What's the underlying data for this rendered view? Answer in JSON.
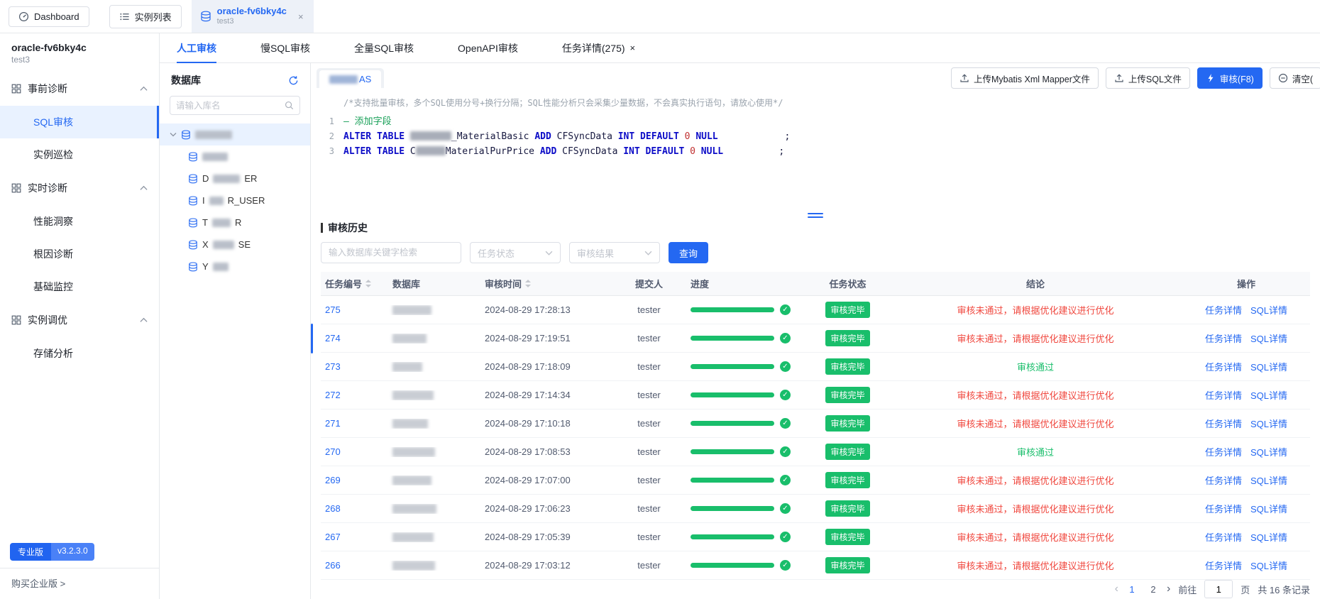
{
  "colors": {
    "primary": "#2468F2",
    "success": "#19BE6B",
    "danger": "#F0483F"
  },
  "icons": {
    "close": "×",
    "check": "✓"
  },
  "topbar": {
    "dashboard": "Dashboard",
    "instance_list": "实例列表",
    "tab": {
      "title": "oracle-fv6bky4c",
      "subtitle": "test3",
      "close": "×"
    }
  },
  "sidebar": {
    "instance_name": "oracle-fv6bky4c",
    "instance_sub": "test3",
    "groups": [
      {
        "label": "事前诊断",
        "items": [
          {
            "label": "SQL审核",
            "active": true
          },
          {
            "label": "实例巡检",
            "active": false
          }
        ]
      },
      {
        "label": "实时诊断",
        "items": [
          {
            "label": "性能洞察",
            "active": false
          },
          {
            "label": "根因诊断",
            "active": false
          },
          {
            "label": "基础监控",
            "active": false
          }
        ]
      },
      {
        "label": "实例调优",
        "items": [
          {
            "label": "存储分析",
            "active": false
          }
        ]
      }
    ],
    "edition": "专业版",
    "version": "v3.2.3.0",
    "buy": "购买企业版 >"
  },
  "main_tabs": [
    {
      "label": "人工审核",
      "active": true,
      "closable": false
    },
    {
      "label": "慢SQL审核",
      "active": false,
      "closable": false
    },
    {
      "label": "全量SQL审核",
      "active": false,
      "closable": false
    },
    {
      "label": "OpenAPI审核",
      "active": false,
      "closable": false
    },
    {
      "label": "任务详情(275)",
      "active": false,
      "closable": true
    }
  ],
  "db_panel": {
    "title": "数据库",
    "search_placeholder": "请输入库名",
    "tree": [
      {
        "root": true,
        "selected": true,
        "prefix": "",
        "redact": 52,
        "suffix": ""
      },
      {
        "root": false,
        "selected": false,
        "prefix": "",
        "redact": 36,
        "suffix": ""
      },
      {
        "root": false,
        "selected": false,
        "prefix": "D",
        "redact": 38,
        "suffix": "ER"
      },
      {
        "root": false,
        "selected": false,
        "prefix": "I",
        "redact": 20,
        "suffix": "R_USER"
      },
      {
        "root": false,
        "selected": false,
        "prefix": "T",
        "redact": 26,
        "suffix": "R"
      },
      {
        "root": false,
        "selected": false,
        "prefix": "X",
        "redact": 30,
        "suffix": "SE"
      },
      {
        "root": false,
        "selected": false,
        "prefix": "Y",
        "redact": 22,
        "suffix": ""
      }
    ]
  },
  "editor": {
    "tab": {
      "redact": 40,
      "suffix": "AS"
    },
    "hint": "/*支持批量审核，多个SQL使用分号+换行分隔；SQL性能分析只会采集少量数据，不会真实执行语句，请放心使用*/",
    "lines": [
      {
        "num": "1",
        "segs": [
          {
            "t": "cmt",
            "v": "— 添加字段"
          }
        ]
      },
      {
        "num": "2",
        "segs": [
          {
            "t": "kw",
            "v": "ALTER TABLE "
          },
          {
            "t": "red",
            "w": 58
          },
          {
            "t": "id",
            "v": "_MaterialBasic "
          },
          {
            "t": "kw",
            "v": "ADD "
          },
          {
            "t": "id",
            "v": "CFSyncData "
          },
          {
            "t": "kw",
            "v": "INT DEFAULT "
          },
          {
            "t": "num",
            "v": "0 "
          },
          {
            "t": "kw",
            "v": "NULL"
          },
          {
            "t": "id",
            "v": "            ;"
          }
        ]
      },
      {
        "num": "3",
        "segs": [
          {
            "t": "kw",
            "v": "ALTER TABLE "
          },
          {
            "t": "id",
            "v": "C"
          },
          {
            "t": "red",
            "w": 42
          },
          {
            "t": "id",
            "v": "MaterialPurPrice "
          },
          {
            "t": "kw",
            "v": "ADD "
          },
          {
            "t": "id",
            "v": "CFSyncData "
          },
          {
            "t": "kw",
            "v": "INT DEFAULT "
          },
          {
            "t": "num",
            "v": "0 "
          },
          {
            "t": "kw",
            "v": "NULL"
          },
          {
            "t": "id",
            "v": "          ;"
          }
        ]
      }
    ]
  },
  "actions": {
    "upload_mapper": "上传Mybatis Xml Mapper文件",
    "upload_sql": "上传SQL文件",
    "audit": "审核(F8)",
    "clear": "清空("
  },
  "history": {
    "title": "审核历史",
    "keyword_placeholder": "输入数据库关键字检索",
    "status_placeholder": "任务状态",
    "result_placeholder": "审核结果",
    "query": "查询",
    "columns": [
      "任务编号",
      "数据库",
      "审核时间",
      "提交人",
      "进度",
      "任务状态",
      "结论",
      "操作"
    ],
    "sortable_columns": [
      "任务编号",
      "审核时间"
    ],
    "status_done": "审核完毕",
    "pass_text": "审核通过",
    "fail_text": "审核未通过，请根据优化建议进行优化",
    "action_links": [
      "任务详情",
      "SQL详情"
    ],
    "rows": [
      {
        "id": "275",
        "db_redact": 55,
        "time": "2024-08-29 17:28:13",
        "submitter": "tester",
        "progress": 100,
        "status": "审核完毕",
        "conclusion": "审核未通过，请根据优化建议进行优化",
        "passed": false
      },
      {
        "id": "274",
        "db_redact": 48,
        "time": "2024-08-29 17:19:51",
        "submitter": "tester",
        "progress": 100,
        "status": "审核完毕",
        "conclusion": "审核未通过，请根据优化建议进行优化",
        "passed": false
      },
      {
        "id": "273",
        "db_redact": 42,
        "time": "2024-08-29 17:18:09",
        "submitter": "tester",
        "progress": 100,
        "status": "审核完毕",
        "conclusion": "审核通过",
        "passed": true
      },
      {
        "id": "272",
        "db_redact": 58,
        "time": "2024-08-29 17:14:34",
        "submitter": "tester",
        "progress": 100,
        "status": "审核完毕",
        "conclusion": "审核未通过，请根据优化建议进行优化",
        "passed": false
      },
      {
        "id": "271",
        "db_redact": 50,
        "time": "2024-08-29 17:10:18",
        "submitter": "tester",
        "progress": 100,
        "status": "审核完毕",
        "conclusion": "审核未通过，请根据优化建议进行优化",
        "passed": false
      },
      {
        "id": "270",
        "db_redact": 60,
        "time": "2024-08-29 17:08:53",
        "submitter": "tester",
        "progress": 100,
        "status": "审核完毕",
        "conclusion": "审核通过",
        "passed": true
      },
      {
        "id": "269",
        "db_redact": 55,
        "time": "2024-08-29 17:07:00",
        "submitter": "tester",
        "progress": 100,
        "status": "审核完毕",
        "conclusion": "审核未通过，请根据优化建议进行优化",
        "passed": false
      },
      {
        "id": "268",
        "db_redact": 62,
        "time": "2024-08-29 17:06:23",
        "submitter": "tester",
        "progress": 100,
        "status": "审核完毕",
        "conclusion": "审核未通过，请根据优化建议进行优化",
        "passed": false
      },
      {
        "id": "267",
        "db_redact": 58,
        "time": "2024-08-29 17:05:39",
        "submitter": "tester",
        "progress": 100,
        "status": "审核完毕",
        "conclusion": "审核未通过，请根据优化建议进行优化",
        "passed": false
      },
      {
        "id": "266",
        "db_redact": 60,
        "time": "2024-08-29 17:03:12",
        "submitter": "tester",
        "progress": 100,
        "status": "审核完毕",
        "conclusion": "审核未通过，请根据优化建议进行优化",
        "passed": false
      }
    ]
  },
  "pagination": {
    "prev": "‹",
    "next": "›",
    "pages": [
      "1",
      "2"
    ],
    "active": "1",
    "goto": "前往",
    "goto_value": "1",
    "unit": "页",
    "total": "共 16 条记录"
  }
}
